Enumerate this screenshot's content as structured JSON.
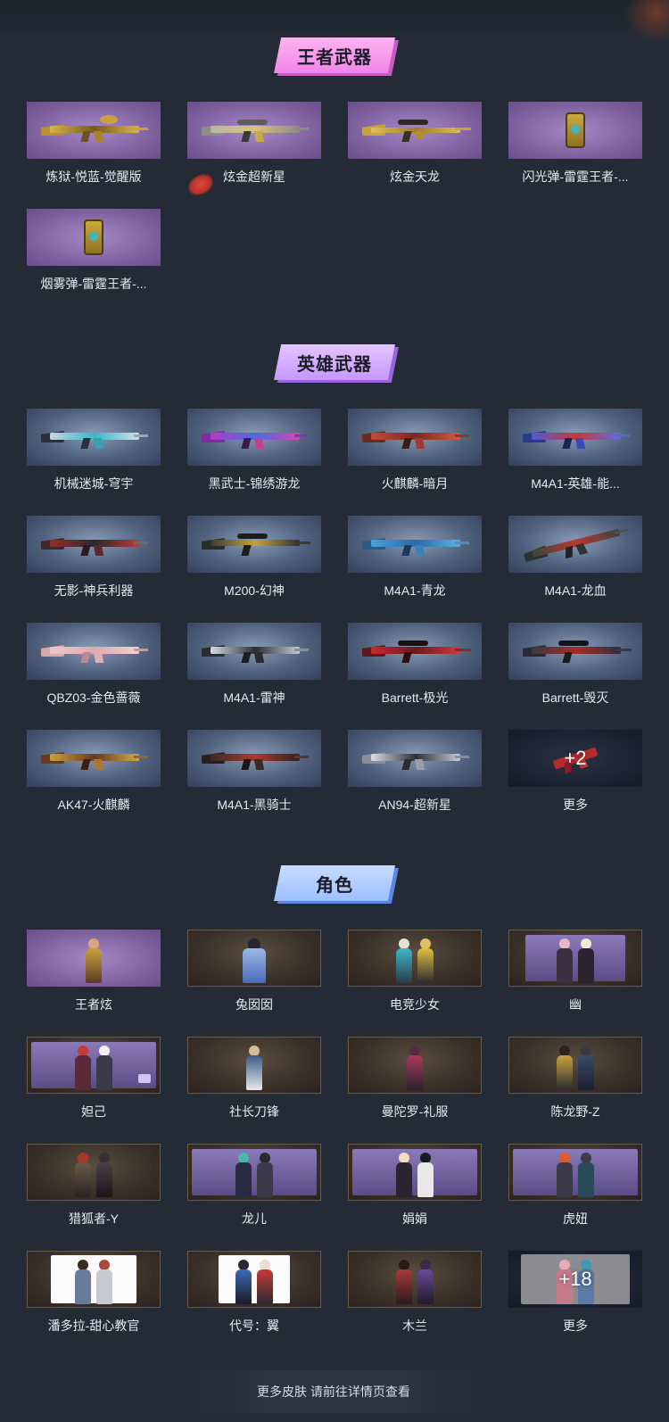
{
  "colors": {
    "background": "#242a36",
    "banner_pink": "#f284e9",
    "banner_purple": "#c597ff",
    "banner_blue": "#9cbfff"
  },
  "sections": {
    "king_weapons": {
      "title": "王者武器",
      "items": [
        {
          "name": "炼狱-悦蓝-觉醒版",
          "icon": "gold-rifle-icon"
        },
        {
          "name": "炫金超新星",
          "icon": "gold-rifle-icon"
        },
        {
          "name": "炫金天龙",
          "icon": "gold-sniper-icon"
        },
        {
          "name": "闪光弹-雷霆王者-...",
          "icon": "flash-grenade-icon"
        },
        {
          "name": "烟雾弹-雷霆王者-...",
          "icon": "smoke-grenade-icon"
        }
      ]
    },
    "hero_weapons": {
      "title": "英雄武器",
      "items": [
        {
          "name": "机械迷城-穹宇"
        },
        {
          "name": "黑武士-锦绣游龙"
        },
        {
          "name": "火麒麟-暗月"
        },
        {
          "name": "M4A1-英雄-能..."
        },
        {
          "name": "无影-神兵利器"
        },
        {
          "name": "M200-幻神"
        },
        {
          "name": "M4A1-青龙"
        },
        {
          "name": "M4A1-龙血"
        },
        {
          "name": "QBZ03-金色蔷薇"
        },
        {
          "name": "M4A1-雷神"
        },
        {
          "name": "Barrett-极光"
        },
        {
          "name": "Barrett-毁灭"
        },
        {
          "name": "AK47-火麒麟"
        },
        {
          "name": "M4A1-黑骑士"
        },
        {
          "name": "AN94-超新星"
        },
        {
          "name": "更多",
          "more_count": "+2"
        }
      ]
    },
    "characters": {
      "title": "角色",
      "items": [
        {
          "name": "王者炫"
        },
        {
          "name": "兔囡囡"
        },
        {
          "name": "电竞少女"
        },
        {
          "name": "幽"
        },
        {
          "name": "妲己"
        },
        {
          "name": "社长刀锋"
        },
        {
          "name": "曼陀罗-礼服"
        },
        {
          "name": "陈龙野-Z"
        },
        {
          "name": "猎狐者-Y"
        },
        {
          "name": "龙儿"
        },
        {
          "name": "娟娟"
        },
        {
          "name": "虎妞"
        },
        {
          "name": "潘多拉-甜心教官"
        },
        {
          "name": "代号：翼"
        },
        {
          "name": "木兰"
        },
        {
          "name": "更多",
          "more_count": "+18"
        }
      ]
    }
  },
  "footer": {
    "text": "更多皮肤 请前往详情页查看"
  }
}
